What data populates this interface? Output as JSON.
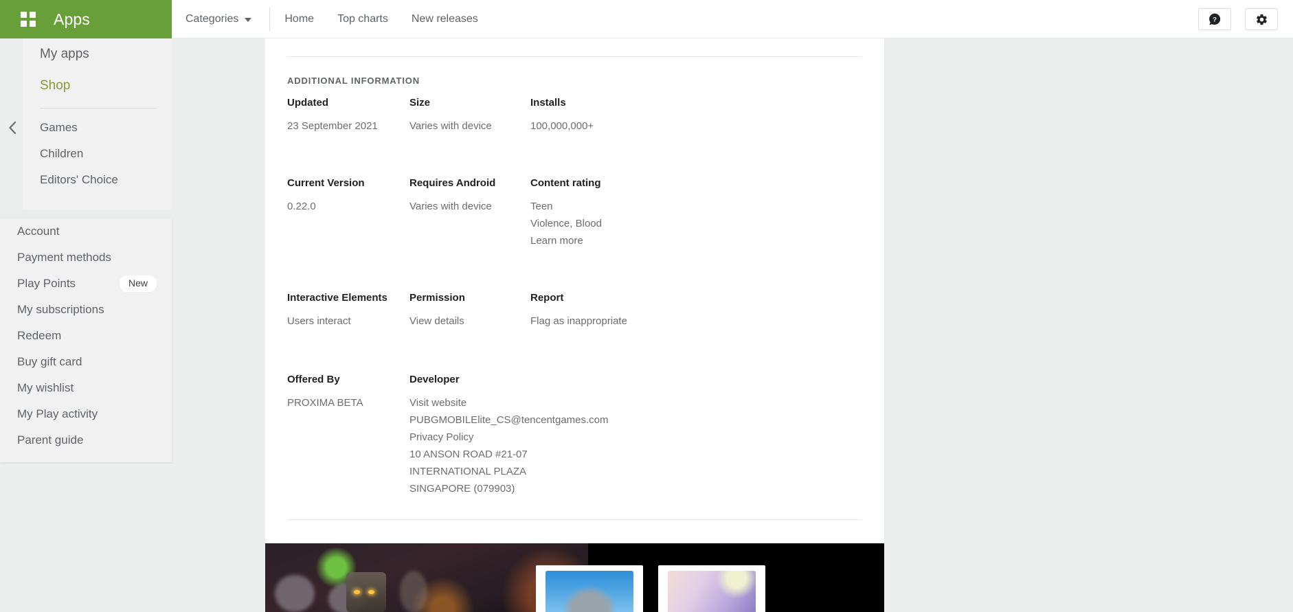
{
  "brand": {
    "title": "Apps",
    "icon": "apps-grid-icon"
  },
  "nav": {
    "categories_label": "Categories",
    "links": [
      {
        "label": "Home"
      },
      {
        "label": "Top charts"
      },
      {
        "label": "New releases"
      }
    ]
  },
  "topbar_actions": [
    {
      "name": "help-icon",
      "glyph": "?"
    },
    {
      "name": "gear-icon",
      "glyph": "⚙"
    }
  ],
  "sidebar": {
    "collapse_icon": "chevron-left-icon",
    "primary": [
      {
        "label": "My apps",
        "active": false
      },
      {
        "label": "Shop",
        "active": true
      }
    ],
    "categories": [
      {
        "label": "Games"
      },
      {
        "label": "Children"
      },
      {
        "label": "Editors' Choice"
      }
    ],
    "account": [
      {
        "label": "Account",
        "badge": ""
      },
      {
        "label": "Payment methods",
        "badge": ""
      },
      {
        "label": "Play Points",
        "badge": "New"
      },
      {
        "label": "My subscriptions",
        "badge": ""
      },
      {
        "label": "Redeem",
        "badge": ""
      },
      {
        "label": "Buy gift card",
        "badge": ""
      },
      {
        "label": "My wishlist",
        "badge": ""
      },
      {
        "label": "My Play activity",
        "badge": ""
      },
      {
        "label": "Parent guide",
        "badge": ""
      }
    ]
  },
  "additional_information": {
    "section_title": "ADDITIONAL INFORMATION",
    "row1": [
      {
        "label": "Updated",
        "values": [
          "23 September 2021"
        ]
      },
      {
        "label": "Size",
        "values": [
          "Varies with device"
        ]
      },
      {
        "label": "Installs",
        "values": [
          "100,000,000+"
        ]
      }
    ],
    "row2": [
      {
        "label": "Current Version",
        "values": [
          "0.22.0"
        ]
      },
      {
        "label": "Requires Android",
        "values": [
          "Varies with device"
        ]
      },
      {
        "label": "Content rating",
        "values": [
          "Teen",
          "Violence, Blood",
          "Learn more"
        ]
      }
    ],
    "row3": [
      {
        "label": "Interactive Elements",
        "values": [
          "Users interact"
        ]
      },
      {
        "label": "Permission",
        "values": [
          "View details"
        ]
      },
      {
        "label": "Report",
        "values": [
          "Flag as inappropriate"
        ]
      }
    ],
    "row4": [
      {
        "label": "Offered By",
        "values": [
          "PROXIMA BETA"
        ]
      },
      {
        "label": "Developer",
        "values": [
          "Visit website",
          "PUBGMOBILElite_CS@tencentgames.com",
          "Privacy Policy",
          "10 ANSON ROAD #21-07",
          "INTERNATIONAL PLAZA",
          "SINGAPORE (079903)"
        ]
      },
      {
        "label": "",
        "values": []
      }
    ]
  },
  "promo": {
    "banner_name": "game-artwork-banner",
    "cards": [
      {
        "name": "promo-card-helmet"
      },
      {
        "name": "promo-card-character"
      }
    ]
  },
  "colors": {
    "brand_green": "#689f38",
    "accent_green": "#8a9a35",
    "page_bg": "#eceded",
    "panel_bg": "#f1f1f1",
    "text_primary": "#202124",
    "text_secondary": "#5f6368",
    "text_muted": "#6d6d6d"
  }
}
